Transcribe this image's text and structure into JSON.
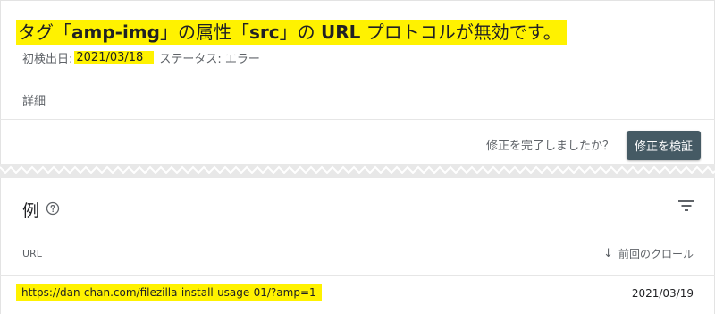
{
  "issue": {
    "title_prefix": "タグ「",
    "title_tag": "amp-img",
    "title_middle": "」の属性「",
    "title_attr": "src",
    "title_middle2": "」の ",
    "title_url": "URL",
    "title_suffix": " プロトコルが無効です。",
    "first_detected_label": "初検出日:",
    "first_detected_date": "2021/03/18",
    "status_text": "ステータス: エラー",
    "details_label": "詳細"
  },
  "validate": {
    "question": "修正を完了しましたか？",
    "button_label": "修正を検証"
  },
  "examples": {
    "section_title": "例",
    "columns": {
      "url": "URL",
      "last_crawl": "前回のクロール"
    },
    "rows": [
      {
        "url": "https://dan-chan.com/filezilla-install-usage-01/?amp=1",
        "last_crawl": "2021/03/19"
      }
    ]
  },
  "icons": {
    "help": "help-circle-icon",
    "filter": "filter-icon",
    "sort": "arrow-down-icon"
  },
  "colors": {
    "highlight": "#fff200",
    "button_bg": "#455a64"
  }
}
